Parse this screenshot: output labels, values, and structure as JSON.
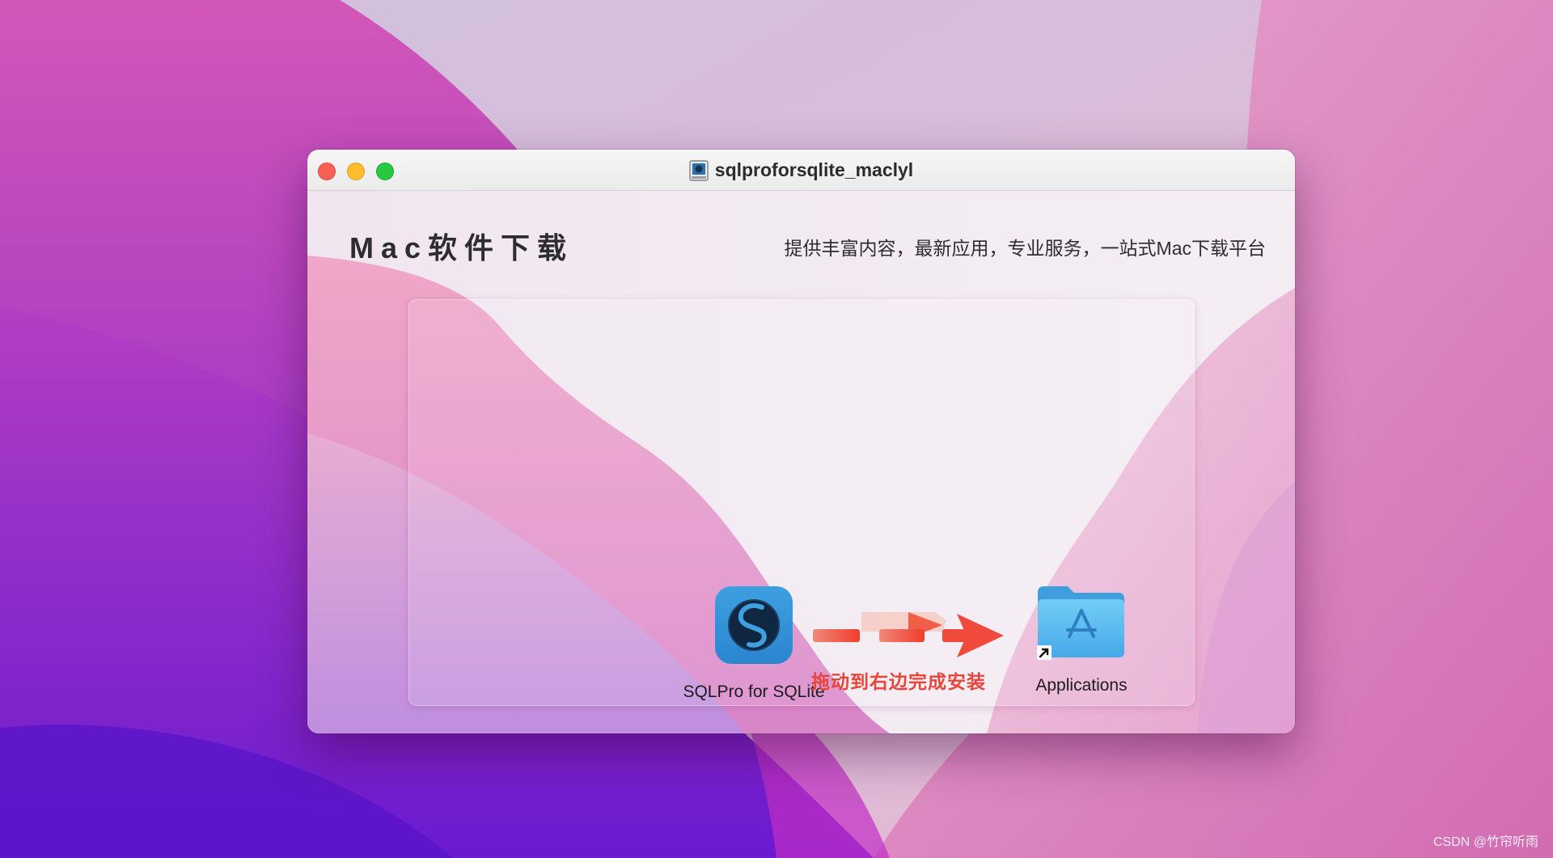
{
  "window": {
    "title": "sqlproforsqlite_maclyl",
    "traffic_lights": [
      "close",
      "minimize",
      "zoom"
    ]
  },
  "header": {
    "brand": "Mac软件下载",
    "tagline": "提供丰富内容，最新应用，专业服务，一站式Mac下载平台"
  },
  "installer": {
    "app_label": "SQLPro for SQLite",
    "hint": "拖动到右边完成安装",
    "target_label": "Applications"
  },
  "watermark": "CSDN @竹帘听雨",
  "colors": {
    "close": "#fe5f57",
    "minimize": "#febc2e",
    "zoom": "#28c840",
    "hint": "#e8453b",
    "folder": "#5bbcf0"
  }
}
